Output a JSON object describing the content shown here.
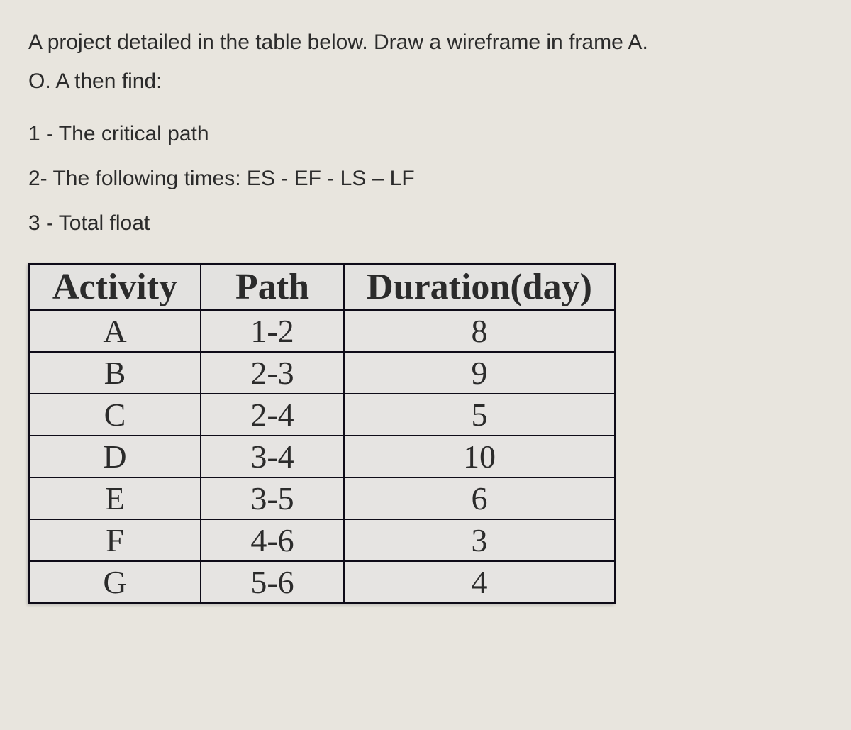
{
  "intro": {
    "line1": "A project detailed in the table below. Draw a wireframe in frame A.",
    "line2": "O. A then find:"
  },
  "questions": {
    "q1": "1 - The critical path",
    "q2": "2- The following times: ES - EF - LS – LF",
    "q3": "3 - Total float"
  },
  "chart_data": {
    "type": "table",
    "title": "Project activities with path and duration",
    "headers": {
      "activity": "Activity",
      "path": "Path",
      "duration": "Duration(day)"
    },
    "rows": [
      {
        "activity": "A",
        "path": "1-2",
        "duration": "8"
      },
      {
        "activity": "B",
        "path": "2-3",
        "duration": "9"
      },
      {
        "activity": "C",
        "path": "2-4",
        "duration": "5"
      },
      {
        "activity": "D",
        "path": "3-4",
        "duration": "10"
      },
      {
        "activity": "E",
        "path": "3-5",
        "duration": "6"
      },
      {
        "activity": "F",
        "path": "4-6",
        "duration": "3"
      },
      {
        "activity": "G",
        "path": "5-6",
        "duration": "4"
      }
    ]
  }
}
